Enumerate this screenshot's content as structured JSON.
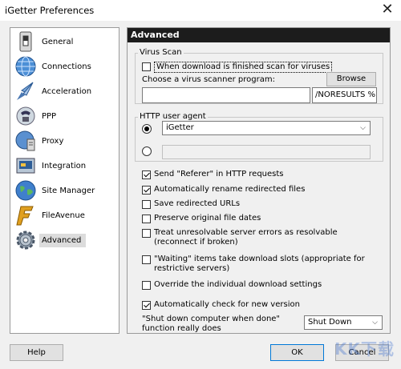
{
  "window": {
    "title": "iGetter Preferences",
    "close_glyph": "✕"
  },
  "sidebar": {
    "items": [
      {
        "label": "General",
        "icon": "switch-icon"
      },
      {
        "label": "Connections",
        "icon": "globe-icon"
      },
      {
        "label": "Acceleration",
        "icon": "rocket-icon"
      },
      {
        "label": "PPP",
        "icon": "phone-icon"
      },
      {
        "label": "Proxy",
        "icon": "server-icon"
      },
      {
        "label": "Integration",
        "icon": "puzzle-icon"
      },
      {
        "label": "Site Manager",
        "icon": "globe-icon"
      },
      {
        "label": "FileAvenue",
        "icon": "f-logo-icon"
      },
      {
        "label": "Advanced",
        "icon": "gear-icon",
        "selected": true
      }
    ]
  },
  "panel": {
    "header": "Advanced",
    "virus_scan": {
      "legend": "Virus Scan",
      "scan_checkbox": {
        "label": "When download is finished scan for viruses",
        "checked": false
      },
      "program_label": "Choose a virus scanner program:",
      "browse_label": "Browse",
      "path_value": "",
      "params_value": "/NORESULTS %F"
    },
    "user_agent": {
      "legend": "HTTP user agent",
      "preset_selected": true,
      "preset_value": "iGetter",
      "custom_selected": false,
      "custom_value": ""
    },
    "options": [
      {
        "label": "Send \"Referer\" in HTTP requests",
        "checked": true
      },
      {
        "label": "Automatically rename redirected files",
        "checked": true
      },
      {
        "label": "Save redirected URLs",
        "checked": false
      },
      {
        "label": "Preserve original file dates",
        "checked": false
      },
      {
        "label": "Treat unresolvable server errors as resolvable (reconnect if broken)",
        "checked": false
      },
      {
        "label": "\"Waiting\" items take download slots (appropriate for restrictive servers)",
        "checked": false
      },
      {
        "label": "Override the individual download settings",
        "checked": false
      },
      {
        "label": "Automatically check for new version",
        "checked": true
      }
    ],
    "shutdown": {
      "label": "\"Shut down computer when done\" function really does",
      "value": "Shut Down"
    }
  },
  "footer": {
    "help_label": "Help",
    "ok_label": "OK",
    "cancel_label": "Cancel"
  },
  "watermark": "KK下载"
}
